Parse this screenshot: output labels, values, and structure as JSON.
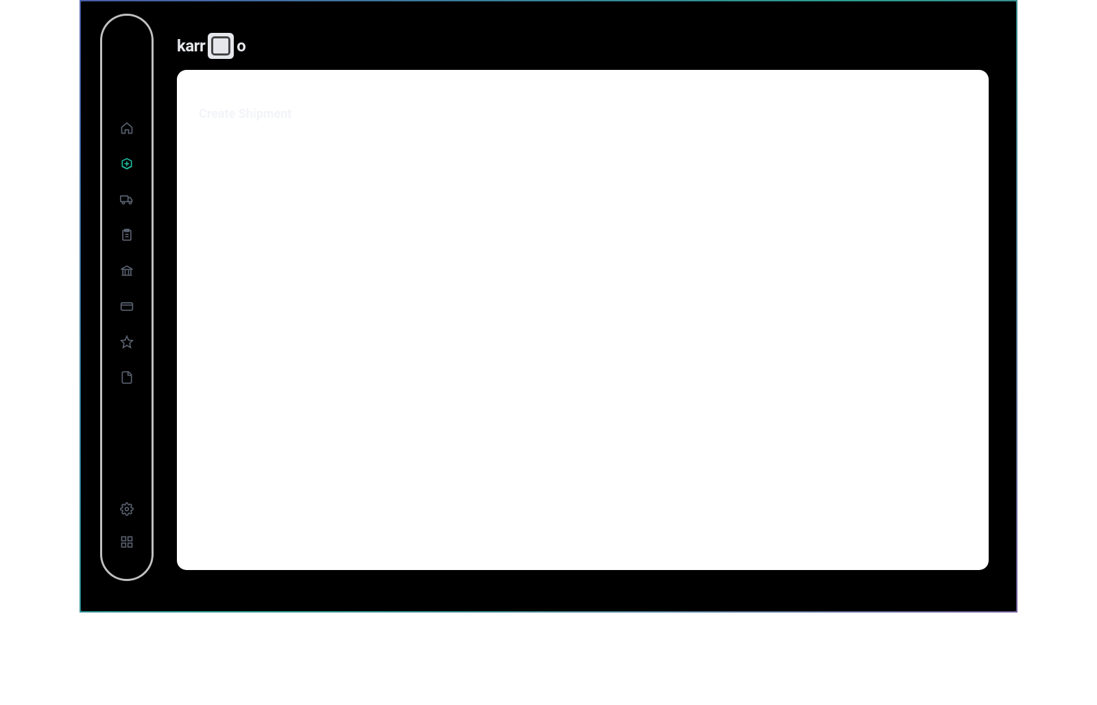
{
  "app": {
    "logo_prefix": "karr",
    "logo_suffix": "o"
  },
  "sidebar": {
    "items": [
      {
        "name": "home",
        "icon": "home-icon",
        "active": false
      },
      {
        "name": "create-shipment",
        "icon": "package-upload-icon",
        "active": true
      },
      {
        "name": "shipments",
        "icon": "truck-icon",
        "active": false
      },
      {
        "name": "orders",
        "icon": "clipboard-icon",
        "active": false
      },
      {
        "name": "payments",
        "icon": "bank-icon",
        "active": false
      },
      {
        "name": "wallet",
        "icon": "credit-card-icon",
        "active": false
      },
      {
        "name": "favorites",
        "icon": "star-icon",
        "active": false
      },
      {
        "name": "documents",
        "icon": "document-icon",
        "active": false
      }
    ],
    "bottom_items": [
      {
        "name": "settings",
        "icon": "settings-icon"
      },
      {
        "name": "apps",
        "icon": "grid-icon"
      }
    ]
  },
  "main": {
    "title": "Create Shipment"
  }
}
